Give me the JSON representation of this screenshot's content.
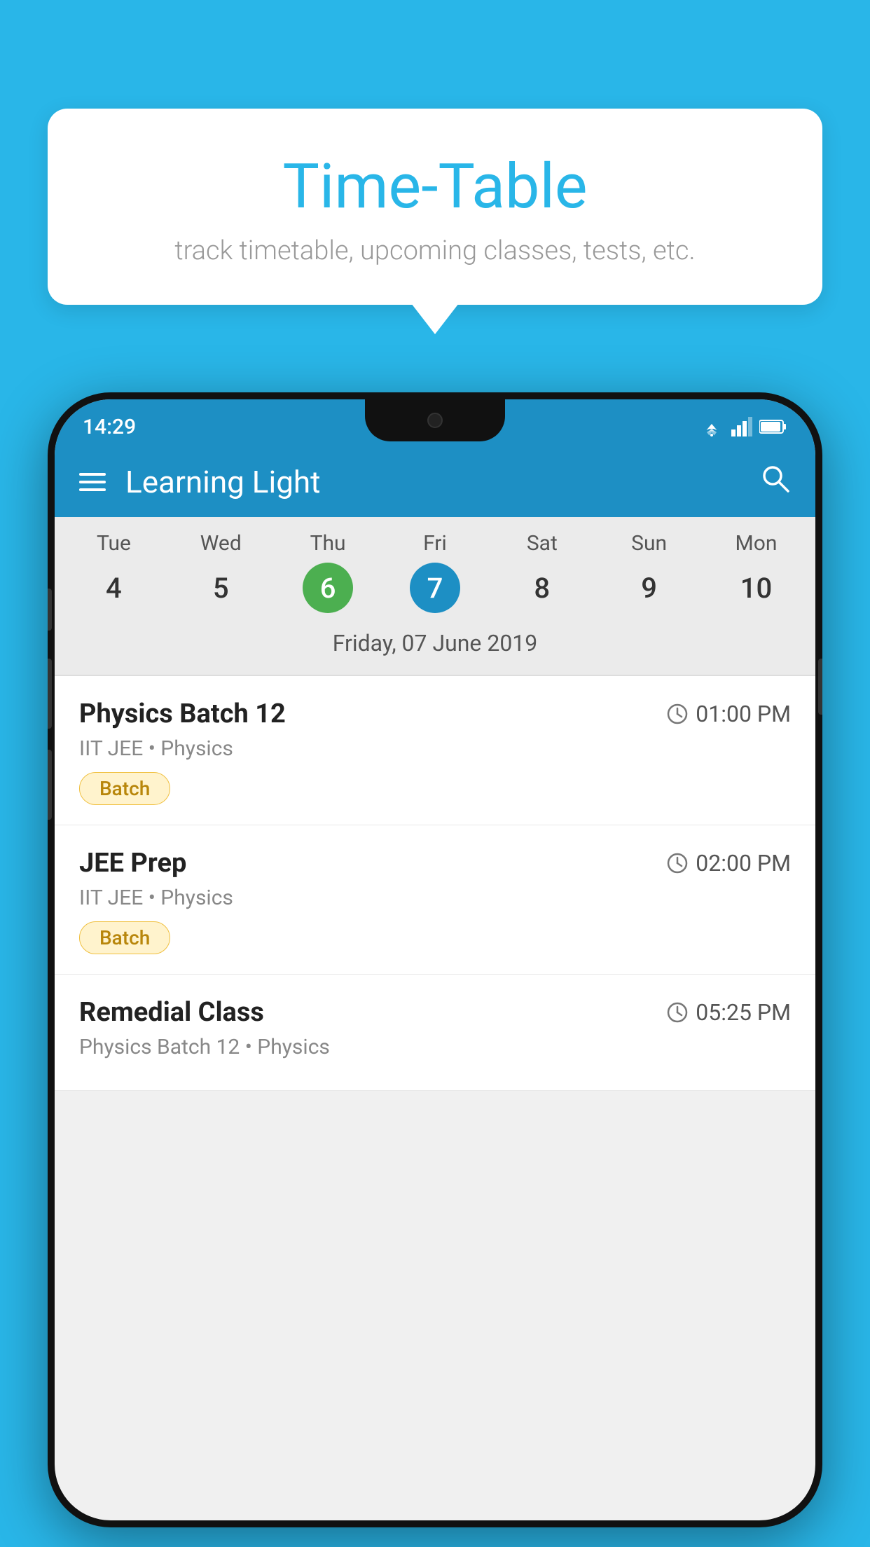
{
  "background_color": "#29b6e8",
  "tooltip": {
    "title": "Time-Table",
    "subtitle": "track timetable, upcoming classes, tests, etc."
  },
  "status_bar": {
    "time": "14:29"
  },
  "app_bar": {
    "title": "Learning Light"
  },
  "calendar": {
    "selected_date_label": "Friday, 07 June 2019",
    "days": [
      {
        "label": "Tue",
        "number": "4",
        "state": "normal"
      },
      {
        "label": "Wed",
        "number": "5",
        "state": "normal"
      },
      {
        "label": "Thu",
        "number": "6",
        "state": "today"
      },
      {
        "label": "Fri",
        "number": "7",
        "state": "selected"
      },
      {
        "label": "Sat",
        "number": "8",
        "state": "normal"
      },
      {
        "label": "Sun",
        "number": "9",
        "state": "normal"
      },
      {
        "label": "Mon",
        "number": "10",
        "state": "normal"
      }
    ]
  },
  "schedule": {
    "items": [
      {
        "title": "Physics Batch 12",
        "time": "01:00 PM",
        "subtitle": "IIT JEE • Physics",
        "badge": "Batch"
      },
      {
        "title": "JEE Prep",
        "time": "02:00 PM",
        "subtitle": "IIT JEE • Physics",
        "badge": "Batch"
      },
      {
        "title": "Remedial Class",
        "time": "05:25 PM",
        "subtitle": "Physics Batch 12 • Physics",
        "badge": null
      }
    ]
  },
  "icons": {
    "hamburger": "☰",
    "search": "🔍",
    "clock": "🕐"
  }
}
